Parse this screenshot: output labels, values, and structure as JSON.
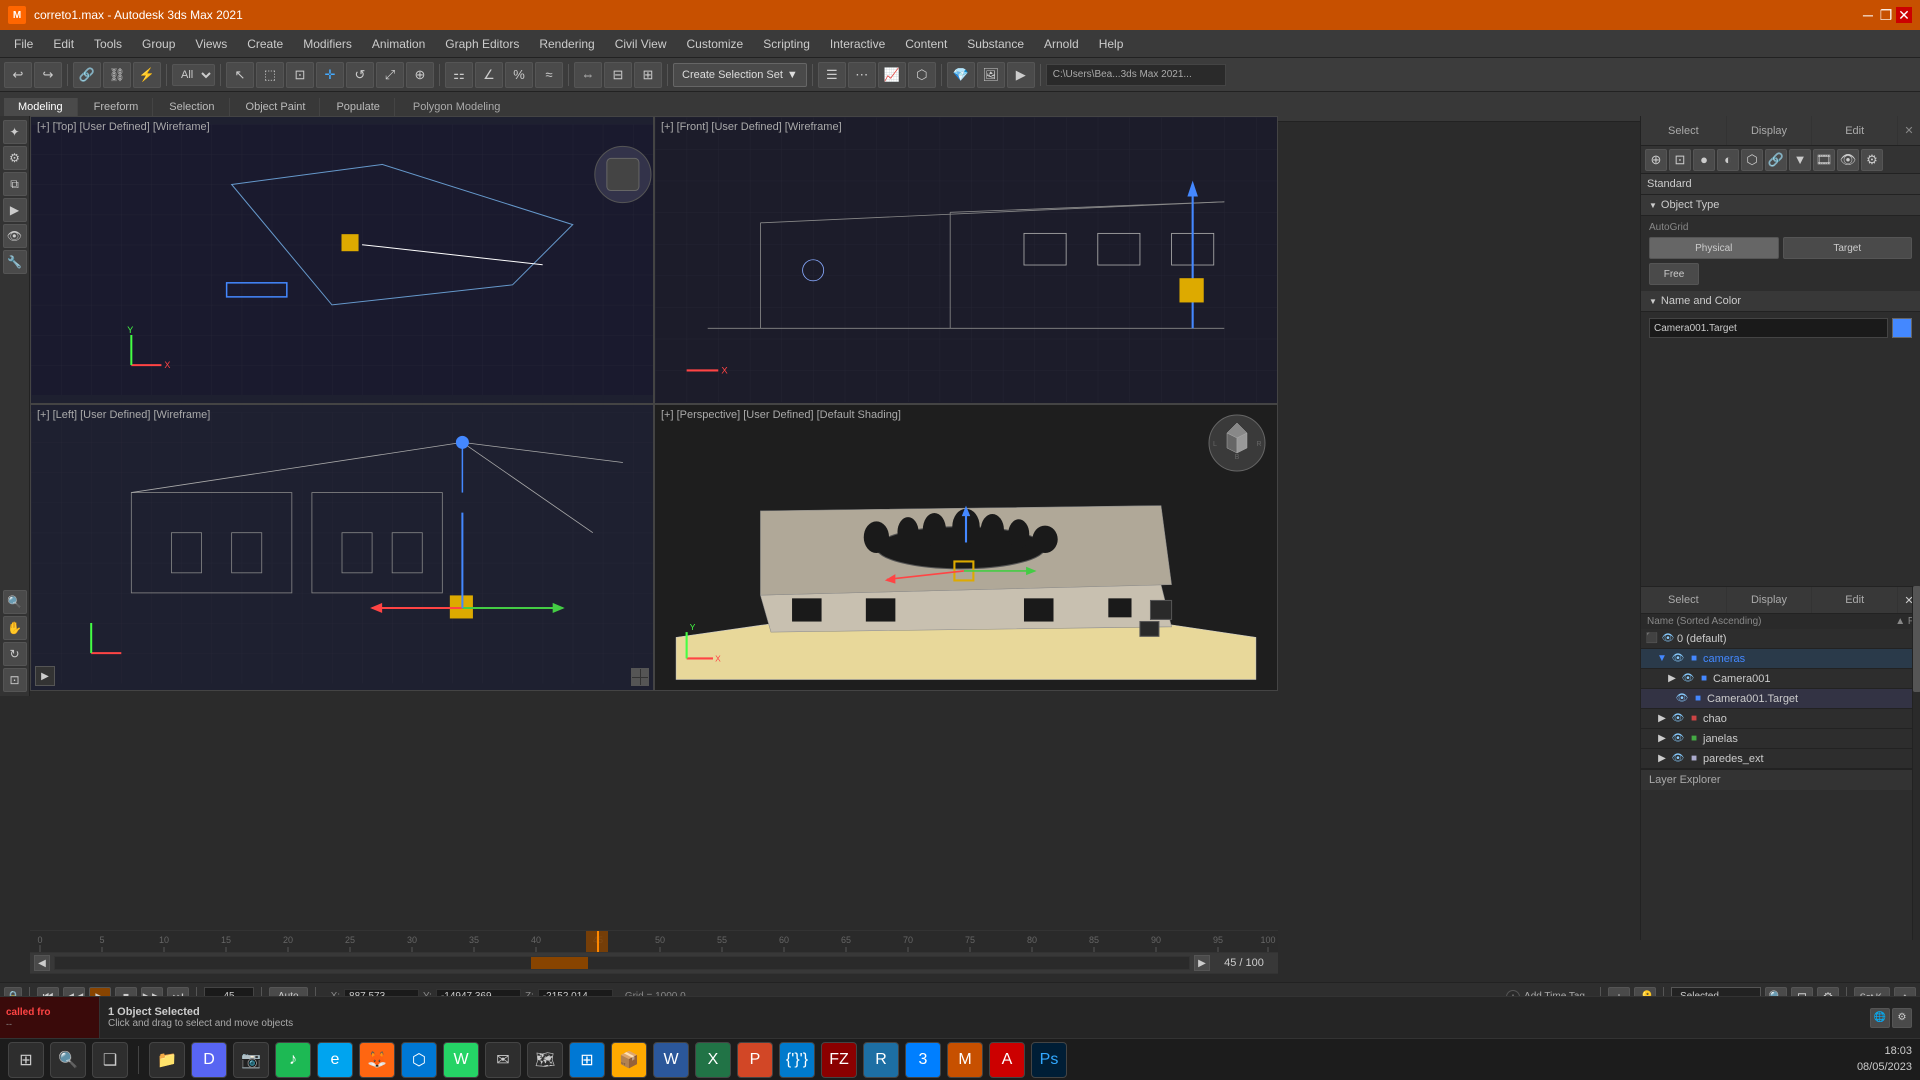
{
  "titlebar": {
    "title": "correto1.max - Autodesk 3ds Max 2021",
    "icon": "3dsmax",
    "controls": [
      "minimize",
      "restore",
      "close"
    ]
  },
  "menubar": {
    "items": [
      "File",
      "Edit",
      "Tools",
      "Group",
      "Views",
      "Create",
      "Modifiers",
      "Animation",
      "Graph Editors",
      "Rendering",
      "Civil View",
      "Customize",
      "Scripting",
      "Interactive",
      "Content",
      "Substance",
      "Arnold",
      "Help"
    ]
  },
  "toolbar": {
    "filter_label": "All",
    "create_selection_set": "Create Selection Set",
    "path": "C:\\Users\\Bea...3ds Max 2021...",
    "snap_dropdown": "All"
  },
  "modeling_tabs": {
    "tabs": [
      "Modeling",
      "Freeform",
      "Selection",
      "Object Paint",
      "Populate"
    ],
    "active": "Modeling",
    "sub_label": "Polygon Modeling"
  },
  "viewports": {
    "top_left": {
      "label": "[+] [Top] [User Defined] [Wireframe]"
    },
    "top_right": {
      "label": "[+] [Front] [User Defined] [Wireframe]"
    },
    "bottom_left": {
      "label": "[+] [Left] [User Defined] [Wireframe]"
    },
    "bottom_right": {
      "label": "[+] [Perspective] [User Defined] [Default Shading]"
    }
  },
  "right_panel": {
    "tabs": [
      "Select",
      "Display",
      "Edit"
    ],
    "standard_label": "Standard",
    "object_type": {
      "header": "Object Type",
      "autogrid": "AutoGrid",
      "buttons": [
        "Physical",
        "Target",
        "Free"
      ]
    },
    "name_and_color": {
      "header": "Name and Color",
      "value": "Camera001.Target",
      "color": "#4488ff"
    }
  },
  "scene_tree": {
    "header_tabs": [
      "Select",
      "Display",
      "Edit"
    ],
    "col_header": "Name (Sorted Ascending)",
    "rows": [
      {
        "label": "0 (default)",
        "depth": 0,
        "type": "layer",
        "visible": true
      },
      {
        "label": "cameras",
        "depth": 1,
        "type": "group",
        "visible": true,
        "color": "#4488ff"
      },
      {
        "label": "Camera001",
        "depth": 2,
        "type": "camera",
        "visible": true
      },
      {
        "label": "Camera001.Target",
        "depth": 3,
        "type": "target",
        "visible": true
      },
      {
        "label": "chao",
        "depth": 1,
        "type": "mesh",
        "visible": true
      },
      {
        "label": "janelas",
        "depth": 1,
        "type": "mesh",
        "visible": true
      },
      {
        "label": "paredes_ext",
        "depth": 1,
        "type": "mesh",
        "visible": false
      }
    ],
    "layer_explorer": "Layer Explorer"
  },
  "timeline": {
    "frame_current": "45",
    "frame_total": "100",
    "frame_display": "45 / 100",
    "ruler_marks": [
      "0",
      "5",
      "10",
      "15",
      "20",
      "25",
      "30",
      "35",
      "40",
      "45",
      "50",
      "55",
      "60",
      "65",
      "70",
      "75",
      "80",
      "85",
      "90",
      "95",
      "100"
    ]
  },
  "anim_controls": {
    "buttons": [
      "⏮",
      "◀",
      "⏹",
      "▶",
      "⏭"
    ],
    "mode": "Auto",
    "frame_input": "45",
    "selected_label": "Selected"
  },
  "coords": {
    "x_label": "X:",
    "x_val": "887,573",
    "y_label": "Y:",
    "y_val": "-14947,369",
    "z_label": "Z:",
    "z_val": "-2152,014",
    "grid": "Grid = 1000,0"
  },
  "statusbar": {
    "status_text": "1 Object Selected",
    "hint_text": "Click and drag to select and move objects",
    "called_from": "called fro",
    "time_stamp": "Add Time Tag",
    "set_k": "Set K."
  },
  "win_taskbar": {
    "time": "18:03",
    "date": "08/05/2023",
    "apps": [
      "⊞",
      "🔍",
      "📁",
      "💬",
      "📷",
      "🎵",
      "🌐",
      "📧",
      "🦊",
      "🌐",
      "📂",
      "📦",
      "🔧",
      "📊",
      "🎮",
      "🔴",
      "📗",
      "💻",
      "🔵",
      "🎯"
    ]
  }
}
